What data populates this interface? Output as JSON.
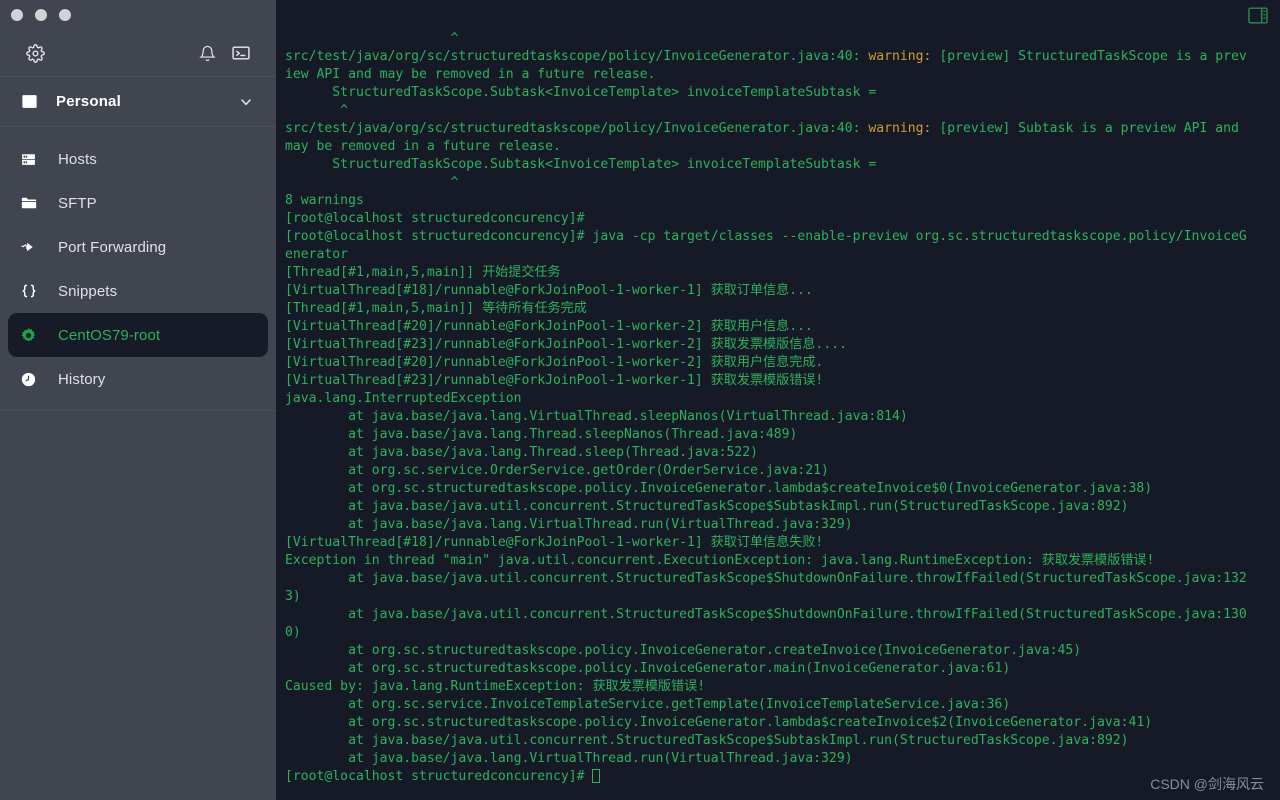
{
  "window": {
    "traffic_lights": [
      "close",
      "minimize",
      "maximize"
    ]
  },
  "sidebar": {
    "toolbar": {
      "settings_label": "settings-gear",
      "notifications_label": "notifications-bell",
      "terminal_label": "new-terminal"
    },
    "workspace": {
      "label": "Personal",
      "icon": "safe-icon",
      "chevron": "chevron-down"
    },
    "items": [
      {
        "label": "Hosts",
        "icon": "server-icon",
        "selected": false
      },
      {
        "label": "SFTP",
        "icon": "folder-icon",
        "selected": false
      },
      {
        "label": "Port Forwarding",
        "icon": "port-forwarding-icon",
        "selected": false
      },
      {
        "label": "Snippets",
        "icon": "braces-icon",
        "selected": false
      },
      {
        "label": "CentOS79-root",
        "icon": "gear-icon",
        "selected": true
      },
      {
        "label": "History",
        "icon": "clock-icon",
        "selected": false
      }
    ]
  },
  "terminal": {
    "layout_icon": "split-pane-icon",
    "colors": {
      "background": "#151a26",
      "foreground": "#2bb35a",
      "warning": "#cf9f2a"
    },
    "prompt": "[root@localhost structuredconcurency]#",
    "cursor": "block-cursor",
    "lines": [
      {
        "segments": [
          {
            "text": "                     ^"
          }
        ]
      },
      {
        "segments": [
          {
            "text": "src/test/java/org/sc/structuredtaskscope/policy/InvoiceGenerator.java:40: "
          },
          {
            "text": "warning:",
            "type": "warn"
          },
          {
            "text": " [preview] StructuredTaskScope is a prev"
          }
        ]
      },
      {
        "segments": [
          {
            "text": "iew API and may be removed in a future release."
          }
        ]
      },
      {
        "segments": [
          {
            "text": "      StructuredTaskScope.Subtask<InvoiceTemplate> invoiceTemplateSubtask ="
          }
        ]
      },
      {
        "segments": [
          {
            "text": "       ^"
          }
        ]
      },
      {
        "segments": [
          {
            "text": "src/test/java/org/sc/structuredtaskscope/policy/InvoiceGenerator.java:40: "
          },
          {
            "text": "warning:",
            "type": "warn"
          },
          {
            "text": " [preview] Subtask is a preview API and"
          }
        ]
      },
      {
        "segments": [
          {
            "text": "may be removed in a future release."
          }
        ]
      },
      {
        "segments": [
          {
            "text": "      StructuredTaskScope.Subtask<InvoiceTemplate> invoiceTemplateSubtask ="
          }
        ]
      },
      {
        "segments": [
          {
            "text": "                     ^"
          }
        ]
      },
      {
        "segments": [
          {
            "text": "8 warnings"
          }
        ]
      },
      {
        "segments": [
          {
            "text": "[root@localhost structuredconcurency]#"
          }
        ]
      },
      {
        "segments": [
          {
            "text": "[root@localhost structuredconcurency]# java -cp target/classes --enable-preview org.sc.structuredtaskscope.policy/InvoiceG"
          }
        ]
      },
      {
        "segments": [
          {
            "text": "enerator"
          }
        ]
      },
      {
        "segments": [
          {
            "text": "[Thread[#1,main,5,main]] 开始提交任务"
          }
        ]
      },
      {
        "segments": [
          {
            "text": "[VirtualThread[#18]/runnable@ForkJoinPool-1-worker-1] 获取订单信息..."
          }
        ]
      },
      {
        "segments": [
          {
            "text": "[Thread[#1,main,5,main]] 等待所有任务完成"
          }
        ]
      },
      {
        "segments": [
          {
            "text": "[VirtualThread[#20]/runnable@ForkJoinPool-1-worker-2] 获取用户信息..."
          }
        ]
      },
      {
        "segments": [
          {
            "text": "[VirtualThread[#23]/runnable@ForkJoinPool-1-worker-2] 获取发票模版信息...."
          }
        ]
      },
      {
        "segments": [
          {
            "text": "[VirtualThread[#20]/runnable@ForkJoinPool-1-worker-2] 获取用户信息完成."
          }
        ]
      },
      {
        "segments": [
          {
            "text": "[VirtualThread[#23]/runnable@ForkJoinPool-1-worker-1] 获取发票模版错误!"
          }
        ]
      },
      {
        "segments": [
          {
            "text": "java.lang.InterruptedException"
          }
        ]
      },
      {
        "segments": [
          {
            "text": "        at java.base/java.lang.VirtualThread.sleepNanos(VirtualThread.java:814)"
          }
        ]
      },
      {
        "segments": [
          {
            "text": "        at java.base/java.lang.Thread.sleepNanos(Thread.java:489)"
          }
        ]
      },
      {
        "segments": [
          {
            "text": "        at java.base/java.lang.Thread.sleep(Thread.java:522)"
          }
        ]
      },
      {
        "segments": [
          {
            "text": "        at org.sc.service.OrderService.getOrder(OrderService.java:21)"
          }
        ]
      },
      {
        "segments": [
          {
            "text": "        at org.sc.structuredtaskscope.policy.InvoiceGenerator.lambda$createInvoice$0(InvoiceGenerator.java:38)"
          }
        ]
      },
      {
        "segments": [
          {
            "text": "        at java.base/java.util.concurrent.StructuredTaskScope$SubtaskImpl.run(StructuredTaskScope.java:892)"
          }
        ]
      },
      {
        "segments": [
          {
            "text": "        at java.base/java.lang.VirtualThread.run(VirtualThread.java:329)"
          }
        ]
      },
      {
        "segments": [
          {
            "text": "[VirtualThread[#18]/runnable@ForkJoinPool-1-worker-1] 获取订单信息失败!"
          }
        ]
      },
      {
        "segments": [
          {
            "text": "Exception in thread \"main\" java.util.concurrent.ExecutionException: java.lang.RuntimeException: 获取发票模版错误!"
          }
        ]
      },
      {
        "segments": [
          {
            "text": "        at java.base/java.util.concurrent.StructuredTaskScope$ShutdownOnFailure.throwIfFailed(StructuredTaskScope.java:132"
          }
        ]
      },
      {
        "segments": [
          {
            "text": "3)"
          }
        ]
      },
      {
        "segments": [
          {
            "text": "        at java.base/java.util.concurrent.StructuredTaskScope$ShutdownOnFailure.throwIfFailed(StructuredTaskScope.java:130"
          }
        ]
      },
      {
        "segments": [
          {
            "text": "0)"
          }
        ]
      },
      {
        "segments": [
          {
            "text": "        at org.sc.structuredtaskscope.policy.InvoiceGenerator.createInvoice(InvoiceGenerator.java:45)"
          }
        ]
      },
      {
        "segments": [
          {
            "text": "        at org.sc.structuredtaskscope.policy.InvoiceGenerator.main(InvoiceGenerator.java:61)"
          }
        ]
      },
      {
        "segments": [
          {
            "text": "Caused by: java.lang.RuntimeException: 获取发票模版错误!"
          }
        ]
      },
      {
        "segments": [
          {
            "text": "        at org.sc.service.InvoiceTemplateService.getTemplate(InvoiceTemplateService.java:36)"
          }
        ]
      },
      {
        "segments": [
          {
            "text": "        at org.sc.structuredtaskscope.policy.InvoiceGenerator.lambda$createInvoice$2(InvoiceGenerator.java:41)"
          }
        ]
      },
      {
        "segments": [
          {
            "text": "        at java.base/java.util.concurrent.StructuredTaskScope$SubtaskImpl.run(StructuredTaskScope.java:892)"
          }
        ]
      },
      {
        "segments": [
          {
            "text": "        at java.base/java.lang.VirtualThread.run(VirtualThread.java:329)"
          }
        ]
      },
      {
        "segments": [
          {
            "text": "[root@localhost structuredconcurency]# ",
            "cursor": true
          }
        ]
      }
    ]
  },
  "watermark": {
    "text": "CSDN @剑海风云"
  }
}
